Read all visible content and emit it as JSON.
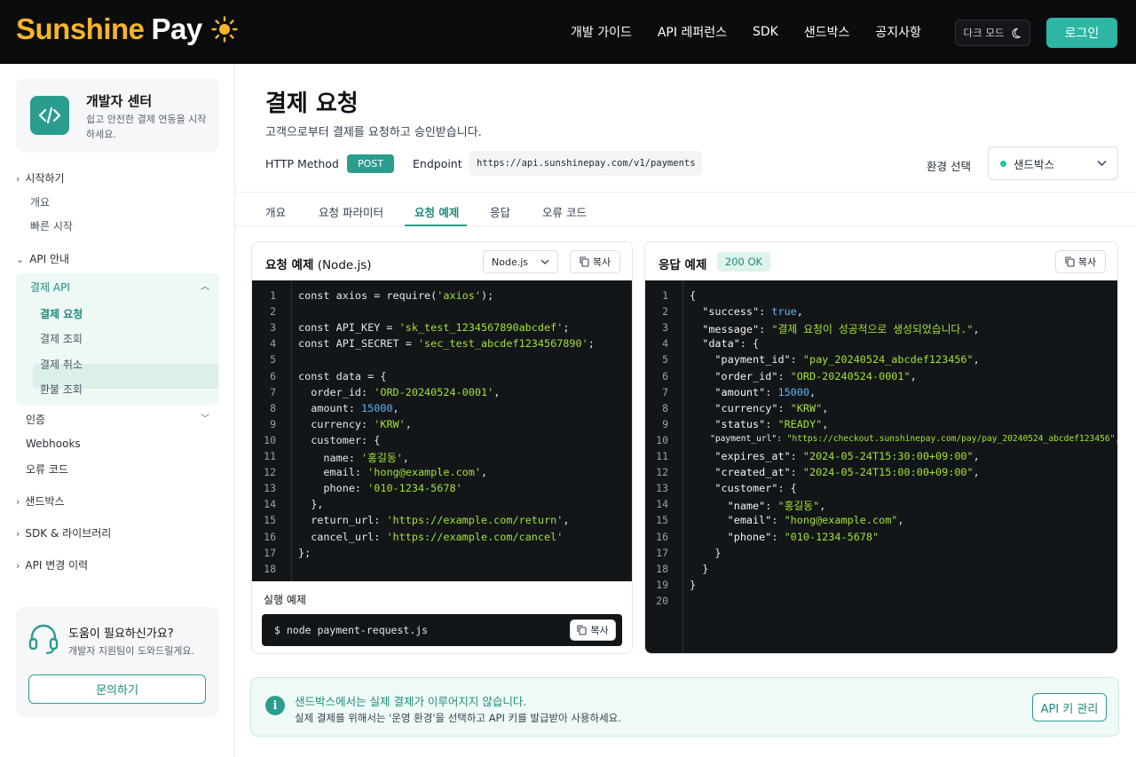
{
  "header": {
    "logo_part1": "Sunshine",
    "logo_part2": "Pay",
    "nav": [
      "개발 가이드",
      "API 레퍼런스",
      "SDK",
      "샌드박스",
      "공지사항"
    ],
    "dark_mode": "다크 모드",
    "login": "로그인"
  },
  "sidebar": {
    "dev_title": "개발자 센터",
    "dev_sub": "쉽고 안전한 결제 연동을 시작하세요.",
    "getting_started": "시작하기",
    "overview": "개요",
    "quick_start": "빠른 시작",
    "api_guide": "API 안내",
    "payment_api": "결제 API",
    "payment_items": [
      "결제 요청",
      "결제 조회",
      "결제 취소",
      "환불 조회"
    ],
    "auth": "인증",
    "webhooks": "Webhooks",
    "error_codes": "오류 코드",
    "sandbox": "샌드박스",
    "sdk_libs": "SDK & 라이브러리",
    "api_changelog": "API 변경 이력",
    "help_title": "도움이 필요하신가요?",
    "help_sub": "개발자 지원팀이 도와드릴게요.",
    "help_button": "문의하기"
  },
  "main": {
    "title": "결제 요청",
    "description": "고객으로부터 결제를 요청하고 승인받습니다.",
    "method_label": "HTTP Method",
    "method": "POST",
    "endpoint_label": "Endpoint",
    "endpoint": "https://api.sunshinepay.com/v1/payments",
    "env_label": "환경 선택",
    "env_value": "샌드박스",
    "tabs": [
      "개요",
      "요청 파라미터",
      "요청 예제",
      "응답",
      "오류 코드"
    ],
    "active_tab": "요청 예제"
  },
  "request_panel": {
    "title": "요청 예제",
    "title_suffix": "(Node.js)",
    "lang_select": "Node.js",
    "copy": "복사",
    "run_title": "실행 예제",
    "run_command": "$ node payment-request.js"
  },
  "response_panel": {
    "title": "응답 예제",
    "status": "200 OK",
    "copy": "복사"
  },
  "notice": {
    "title": "샌드박스에서는 실제 결제가 이루어지지 않습니다.",
    "body": "실제 결제를 위해서는 '운영 환경'을 선택하고 API 키를 발급받아 사용하세요.",
    "button": "API 키 관리"
  },
  "colors": {
    "brand_yellow": "#f5b52a",
    "accent_teal": "#2a9d8f",
    "code_bg": "#131619",
    "code_string": "#a6e22e",
    "code_number": "#5fb3f5"
  }
}
